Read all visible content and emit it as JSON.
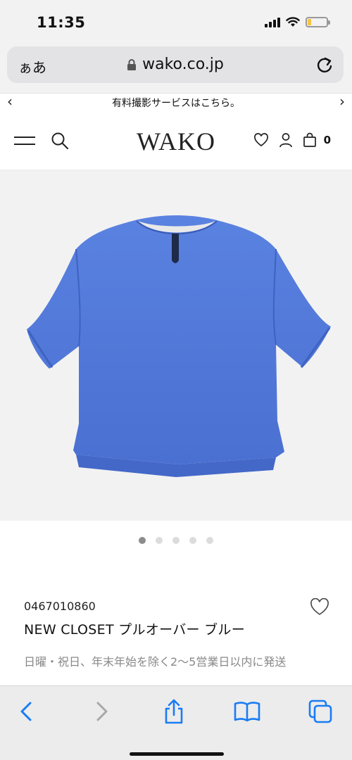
{
  "status_bar": {
    "time": "11:35",
    "icons": [
      "signal-icon",
      "wifi-icon",
      "battery-icon"
    ],
    "battery_level": 0.2,
    "battery_color": "#f4c542"
  },
  "browser": {
    "aa_label": "ぁあ",
    "url": "wako.co.jp",
    "lock_icon": "lock-icon",
    "reload_icon": "reload-icon"
  },
  "banner": {
    "text": "有料撮影サービスはこちら。",
    "prev": "‹",
    "next": "›"
  },
  "site_header": {
    "logo": "WAKO",
    "cart_count": "0",
    "icons": [
      "menu-icon",
      "search-icon",
      "heart-icon",
      "account-icon",
      "cart-icon"
    ]
  },
  "product": {
    "image_description_color": "#4f78d9",
    "carousel": {
      "count": 5,
      "active": 0
    },
    "code": "0467010860",
    "name": "NEW CLOSET プルオーバー ブルー",
    "shipping_note": "日曜・祝日、年末年始を除く2〜5営業日以内に発送"
  },
  "toolbar": {
    "accent": "#1a7cf5",
    "icons": [
      "back-icon",
      "forward-icon",
      "share-icon",
      "bookmarks-icon",
      "tabs-icon"
    ]
  }
}
